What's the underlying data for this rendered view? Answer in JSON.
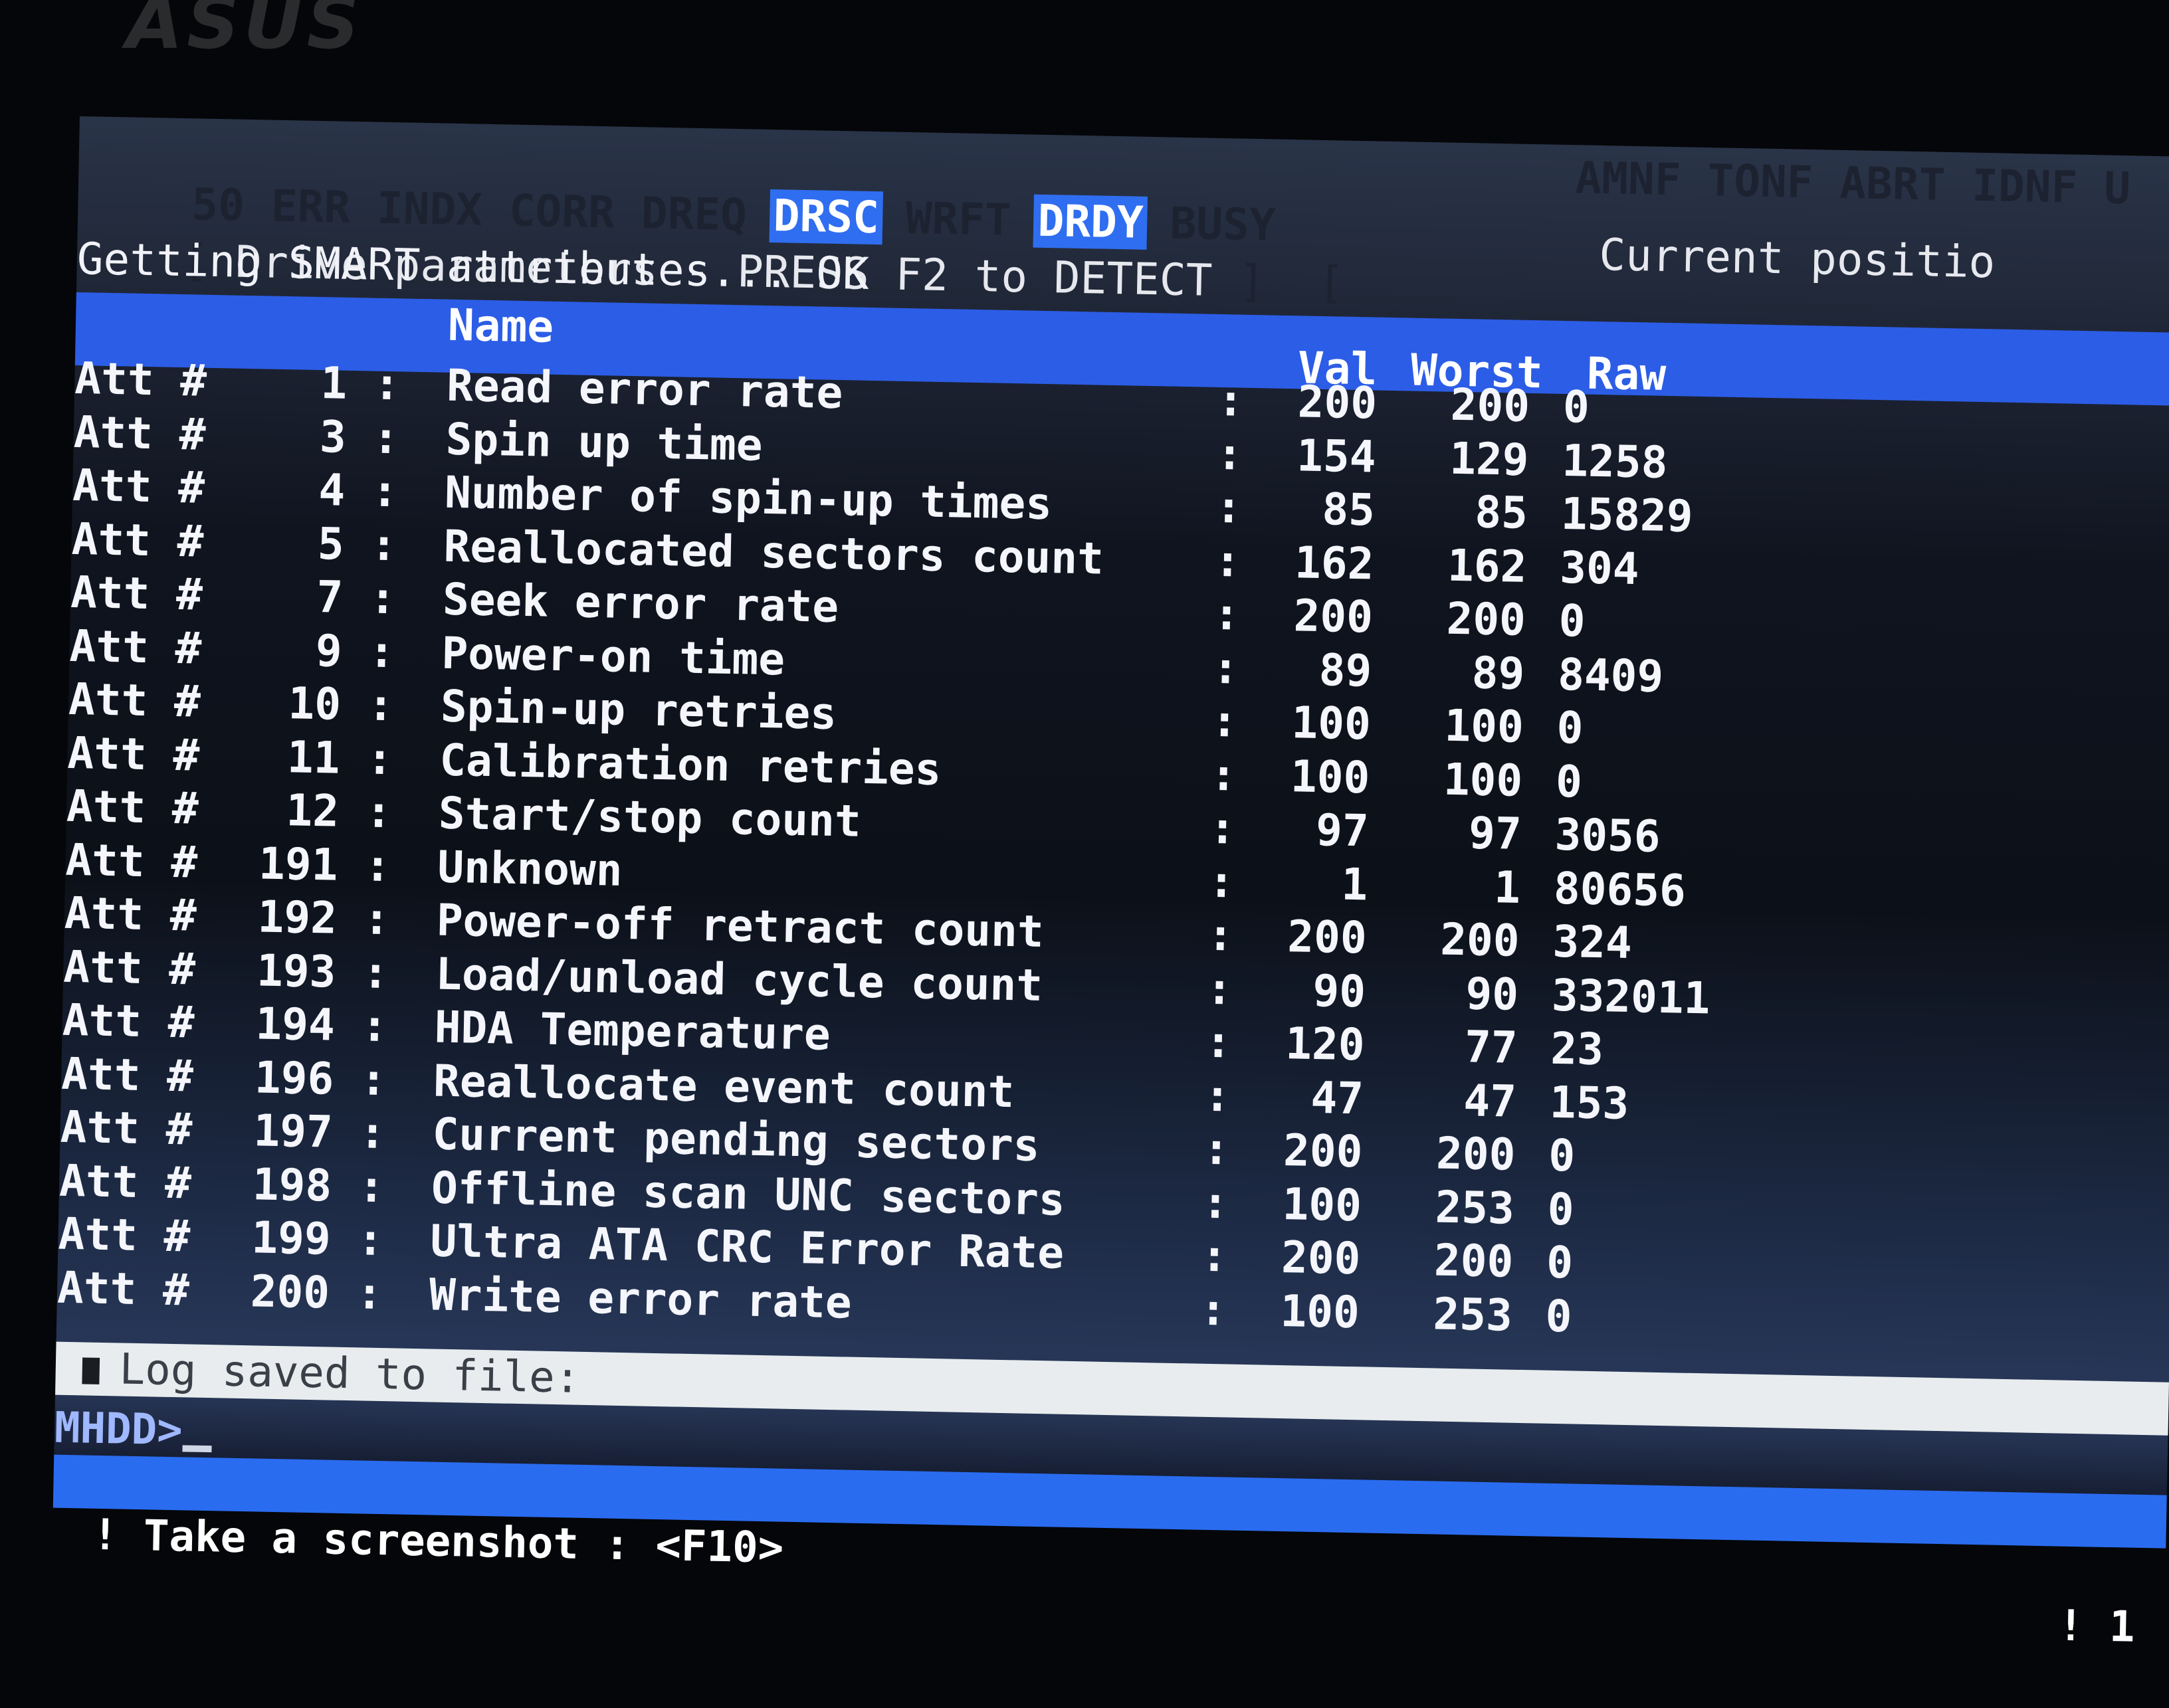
{
  "bezel": {
    "logo": "ASUS"
  },
  "flags": {
    "left": [
      {
        "label": "50",
        "active": false
      },
      {
        "label": "ERR",
        "active": false
      },
      {
        "label": "INDX",
        "active": false
      },
      {
        "label": "CORR",
        "active": false
      },
      {
        "label": "DREQ",
        "active": false
      },
      {
        "label": "DRSC",
        "active": true
      },
      {
        "label": "WRFT",
        "active": false
      },
      {
        "label": "DRDY",
        "active": true
      },
      {
        "label": "BUSY",
        "active": false
      }
    ],
    "right": [
      {
        "label": "AMNF",
        "active": false
      },
      {
        "label": "TONF",
        "active": false
      },
      {
        "label": "ABRT",
        "active": false
      },
      {
        "label": "IDNF",
        "active": false
      },
      {
        "label": "U",
        "active": false
      }
    ]
  },
  "drive_line": {
    "open_bracket": "[",
    "text": "Drive parameters - PRESS F2 to DETECT",
    "close_bracket": "]",
    "second_bracket": "[",
    "position_label": "Current positio"
  },
  "smart_status": "Getting SMART attributes... OK",
  "table": {
    "headers": {
      "name": "Name",
      "val": "Val",
      "worst": "Worst",
      "raw": "Raw"
    },
    "rows": [
      {
        "prefix": "Att #",
        "id": "1",
        "name": "Read error rate",
        "val": "200",
        "worst": "200",
        "raw": "0"
      },
      {
        "prefix": "Att #",
        "id": "3",
        "name": "Spin up time",
        "val": "154",
        "worst": "129",
        "raw": "1258"
      },
      {
        "prefix": "Att #",
        "id": "4",
        "name": "Number of spin-up times",
        "val": "85",
        "worst": "85",
        "raw": "15829"
      },
      {
        "prefix": "Att #",
        "id": "5",
        "name": "Reallocated sectors count",
        "val": "162",
        "worst": "162",
        "raw": "304"
      },
      {
        "prefix": "Att #",
        "id": "7",
        "name": "Seek error rate",
        "val": "200",
        "worst": "200",
        "raw": "0"
      },
      {
        "prefix": "Att #",
        "id": "9",
        "name": "Power-on time",
        "val": "89",
        "worst": "89",
        "raw": "8409"
      },
      {
        "prefix": "Att #",
        "id": "10",
        "name": "Spin-up retries",
        "val": "100",
        "worst": "100",
        "raw": "0"
      },
      {
        "prefix": "Att #",
        "id": "11",
        "name": "Calibration retries",
        "val": "100",
        "worst": "100",
        "raw": "0"
      },
      {
        "prefix": "Att #",
        "id": "12",
        "name": "Start/stop count",
        "val": "97",
        "worst": "97",
        "raw": "3056"
      },
      {
        "prefix": "Att #",
        "id": "191",
        "name": "Unknown",
        "val": "1",
        "worst": "1",
        "raw": "80656"
      },
      {
        "prefix": "Att #",
        "id": "192",
        "name": "Power-off retract count",
        "val": "200",
        "worst": "200",
        "raw": "324"
      },
      {
        "prefix": "Att #",
        "id": "193",
        "name": "Load/unload cycle count",
        "val": "90",
        "worst": "90",
        "raw": "332011"
      },
      {
        "prefix": "Att #",
        "id": "194",
        "name": "HDA Temperature",
        "val": "120",
        "worst": "77",
        "raw": "23"
      },
      {
        "prefix": "Att #",
        "id": "196",
        "name": "Reallocate event count",
        "val": "47",
        "worst": "47",
        "raw": "153"
      },
      {
        "prefix": "Att #",
        "id": "197",
        "name": "Current pending sectors",
        "val": "200",
        "worst": "200",
        "raw": "0"
      },
      {
        "prefix": "Att #",
        "id": "198",
        "name": "Offline scan UNC sectors",
        "val": "100",
        "worst": "253",
        "raw": "0"
      },
      {
        "prefix": "Att #",
        "id": "199",
        "name": "Ultra ATA CRC Error Rate",
        "val": "200",
        "worst": "200",
        "raw": "0"
      },
      {
        "prefix": "Att #",
        "id": "200",
        "name": "Write error rate",
        "val": "100",
        "worst": "253",
        "raw": "0"
      }
    ]
  },
  "log_message": "Log saved to file:",
  "prompt": "MHDD>",
  "status_bar": {
    "hint": "! Take a screenshot : <F10>",
    "right_text": "! 1"
  },
  "colors": {
    "accent_blue": "#2c5de6",
    "status_blue": "#2a6cf0",
    "text": "#f4f6fb",
    "log_bar": "#e8ecee"
  }
}
